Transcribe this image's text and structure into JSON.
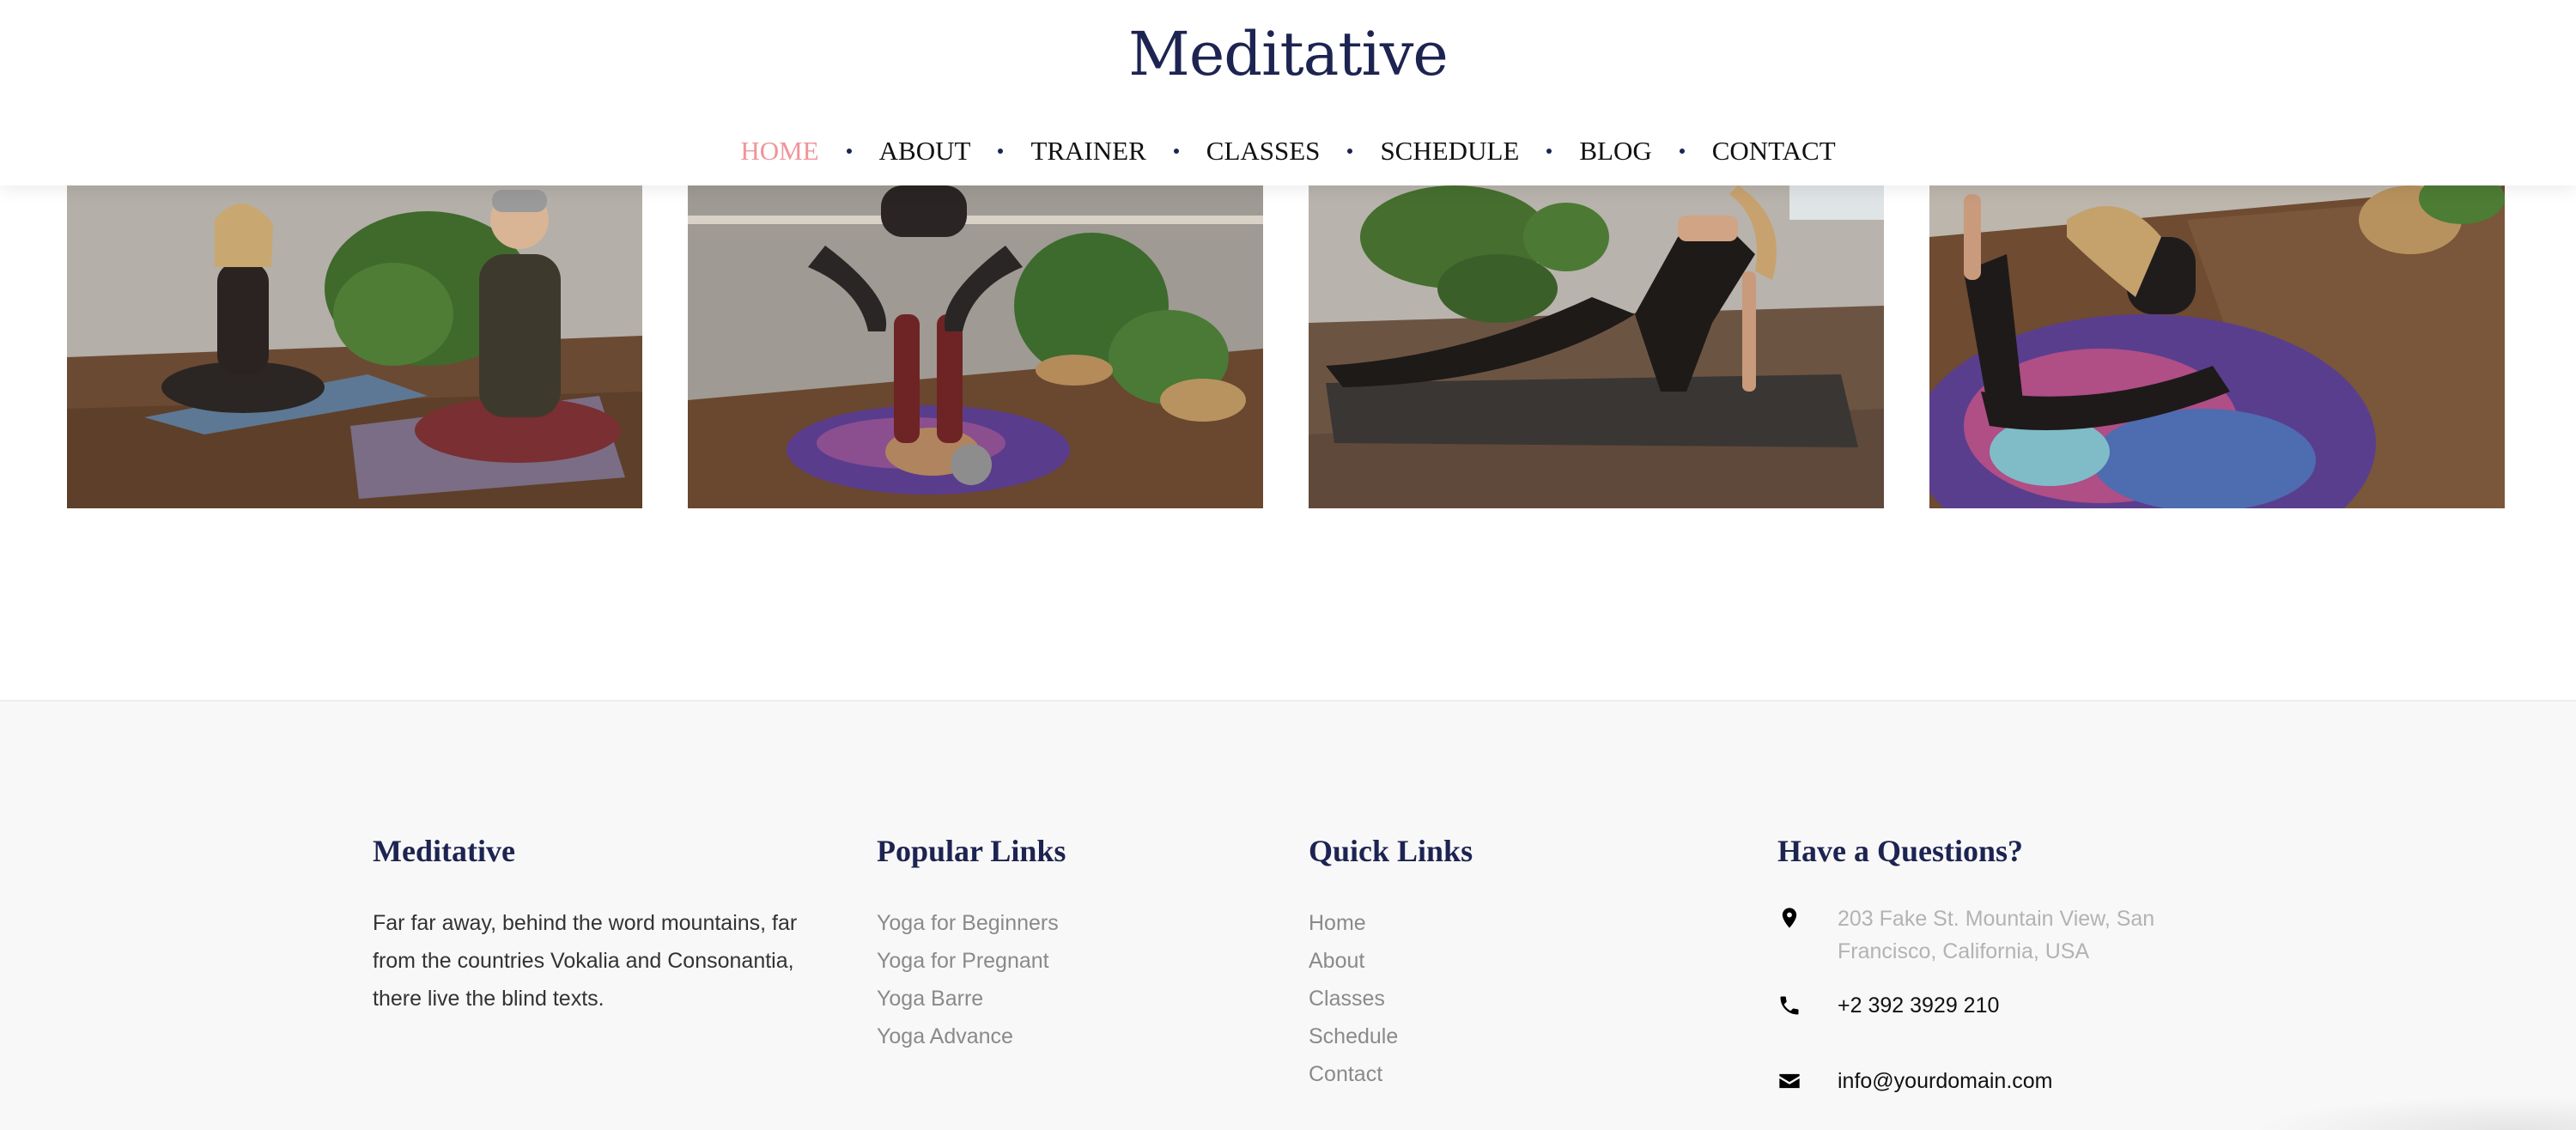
{
  "brand": "Meditative",
  "nav": {
    "items": [
      "HOME",
      "ABOUT",
      "TRAINER",
      "CLASSES",
      "SCHEDULE",
      "BLOG",
      "CONTACT"
    ],
    "active_index": 0
  },
  "footer": {
    "about": {
      "title": "Meditative",
      "text": "Far far away, behind the word mountains, far from the countries Vokalia and Consonantia, there live the blind texts."
    },
    "popular_links": {
      "title": "Popular Links",
      "items": [
        "Yoga for Beginners",
        "Yoga for Pregnant",
        "Yoga Barre",
        "Yoga Advance"
      ]
    },
    "quick_links": {
      "title": "Quick Links",
      "items": [
        "Home",
        "About",
        "Classes",
        "Schedule",
        "Contact"
      ]
    },
    "contact": {
      "title": "Have a Questions?",
      "address": "203 Fake St. Mountain View, San Francisco, California, USA",
      "phone": "+2 392 3929 210",
      "email": "info@yourdomain.com"
    }
  },
  "icons": {
    "address": "map-marker-icon",
    "phone": "phone-icon",
    "email": "envelope-icon"
  },
  "colors": {
    "brand": "#1d2452",
    "nav_active": "#f0949a",
    "footer_bg": "#f8f8f8"
  }
}
